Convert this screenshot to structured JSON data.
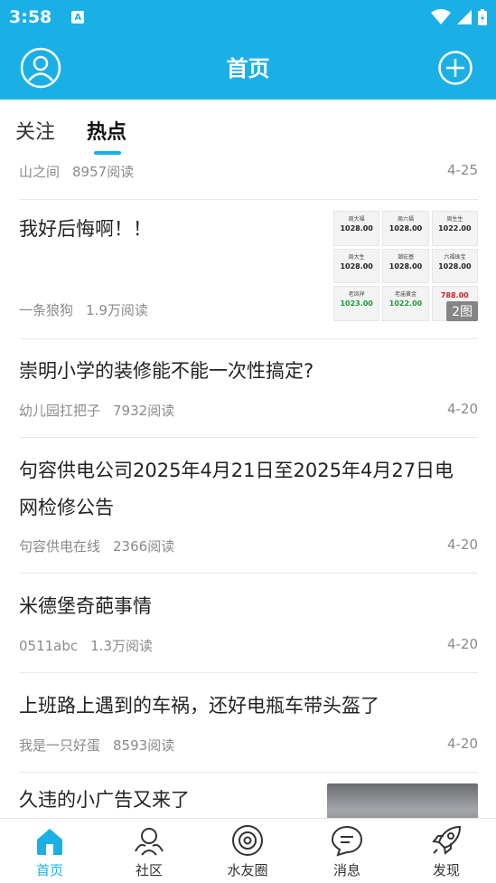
{
  "status_bar": {
    "time": "3:58",
    "notification_glyph": "A"
  },
  "header": {
    "title": "首页",
    "left_icon": "user-avatar-icon",
    "right_icon": "add-circle-icon"
  },
  "tabs": [
    {
      "label": "关注",
      "active": false
    },
    {
      "label": "热点",
      "active": true
    }
  ],
  "feed": {
    "partial_item": {
      "author": "山之间",
      "reads": "8957阅读",
      "date": "4-25"
    },
    "items": [
      {
        "title": "我好后悔啊！！",
        "author": "一条狼狗",
        "reads": "1.9万阅读",
        "date": "",
        "image_count": "2图",
        "thumbnail_cells": [
          {
            "name": "周大福",
            "value": "1028.00"
          },
          {
            "name": "周六福",
            "value": "1028.00"
          },
          {
            "name": "周生生",
            "value": "1022.00"
          },
          {
            "name": "周大生",
            "value": "1028.00"
          },
          {
            "name": "潮宏基",
            "value": "1028.00"
          },
          {
            "name": "六福珠宝",
            "value": "1028.00"
          },
          {
            "name": "老凤祥",
            "value": "1023.00"
          },
          {
            "name": "老庙黄金",
            "value": "1022.00"
          },
          {
            "name": "",
            "value": "788.00"
          }
        ]
      },
      {
        "title": "崇明小学的装修能不能一次性搞定?",
        "author": "幼儿园扛把子",
        "reads": "7932阅读",
        "date": "4-20"
      },
      {
        "title": "句容供电公司2025年4月21日至2025年4月27日电网检修公告",
        "author": "句容供电在线",
        "reads": "2366阅读",
        "date": "4-20"
      },
      {
        "title": "米德堡奇葩事情",
        "author": "0511abc",
        "reads": "1.3万阅读",
        "date": "4-20"
      },
      {
        "title": "上班路上遇到的车祸，还好电瓶车带头盔了",
        "author": "我是一只好蛋",
        "reads": "8593阅读",
        "date": "4-20"
      },
      {
        "title": "久违的小广告又来了",
        "author": "",
        "reads": "",
        "date": ""
      }
    ]
  },
  "bottom_nav": [
    {
      "label": "首页",
      "icon": "home-icon",
      "active": true
    },
    {
      "label": "社区",
      "icon": "community-icon",
      "active": false
    },
    {
      "label": "水友圈",
      "icon": "circle-icon",
      "active": false
    },
    {
      "label": "消息",
      "icon": "message-icon",
      "active": false
    },
    {
      "label": "发现",
      "icon": "rocket-icon",
      "active": false
    }
  ],
  "colors": {
    "primary": "#1AB0E6",
    "text": "#222222",
    "meta": "#8a8a8a"
  }
}
